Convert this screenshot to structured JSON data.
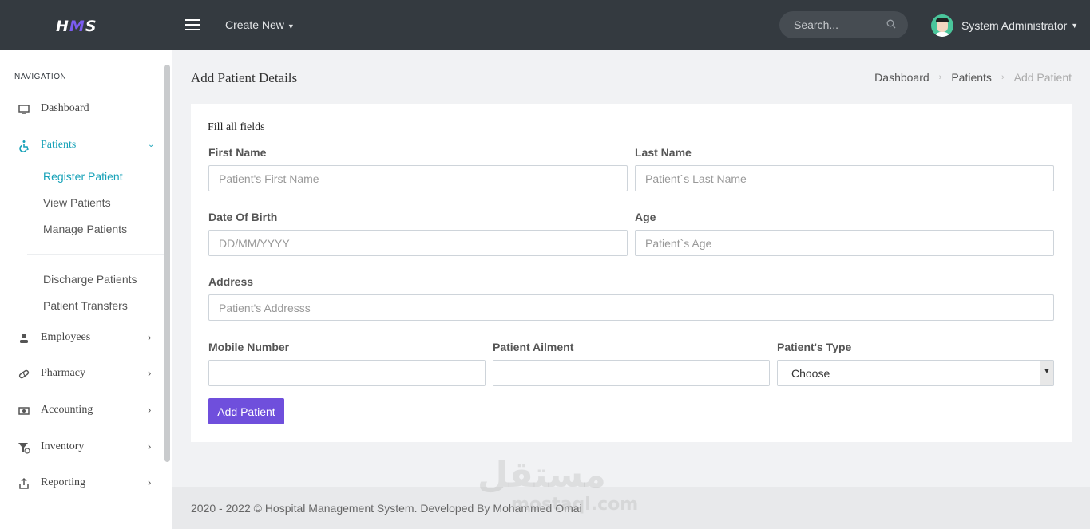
{
  "header": {
    "logo_pre": "H",
    "logo_mid": "M",
    "logo_post": "S",
    "create_new": "Create New",
    "search_placeholder": "Search...",
    "user_name": "System Administrator"
  },
  "sidebar": {
    "title": "NAVIGATION",
    "items": [
      {
        "label": "Dashboard",
        "icon": "monitor-icon"
      },
      {
        "label": "Patients",
        "icon": "wheelchair-icon"
      },
      {
        "label": "Employees",
        "icon": "user-icon"
      },
      {
        "label": "Pharmacy",
        "icon": "pill-icon"
      },
      {
        "label": "Accounting",
        "icon": "cash-icon"
      },
      {
        "label": "Inventory",
        "icon": "funnel-icon"
      },
      {
        "label": "Reporting",
        "icon": "upload-icon"
      }
    ],
    "patient_sub": [
      "Register Patient",
      "View Patients",
      "Manage Patients",
      "Discharge Patients",
      "Patient Transfers"
    ]
  },
  "page": {
    "title": "Add Patient Details",
    "breadcrumb": [
      "Dashboard",
      "Patients",
      "Add Patient"
    ]
  },
  "form": {
    "subtitle": "Fill all fields",
    "first_name": {
      "label": "First Name",
      "placeholder": "Patient's First Name"
    },
    "last_name": {
      "label": "Last Name",
      "placeholder": "Patient`s Last Name"
    },
    "dob": {
      "label": "Date Of Birth",
      "placeholder": "DD/MM/YYYY"
    },
    "age": {
      "label": "Age",
      "placeholder": "Patient`s Age"
    },
    "address": {
      "label": "Address",
      "placeholder": "Patient's Addresss"
    },
    "mobile": {
      "label": "Mobile Number",
      "placeholder": ""
    },
    "ailment": {
      "label": "Patient Ailment",
      "placeholder": ""
    },
    "type": {
      "label": "Patient's Type",
      "selected": "Choose"
    },
    "submit": "Add Patient"
  },
  "footer": {
    "text": "2020 - 2022 © Hospital Management System. Developed By Mohammed Omai"
  },
  "watermark": {
    "main": "مستقل",
    "sub": "mostaql.com"
  },
  "colors": {
    "topbar": "#343a40",
    "accent": "#17a2b8",
    "button": "#6f4fdc"
  }
}
